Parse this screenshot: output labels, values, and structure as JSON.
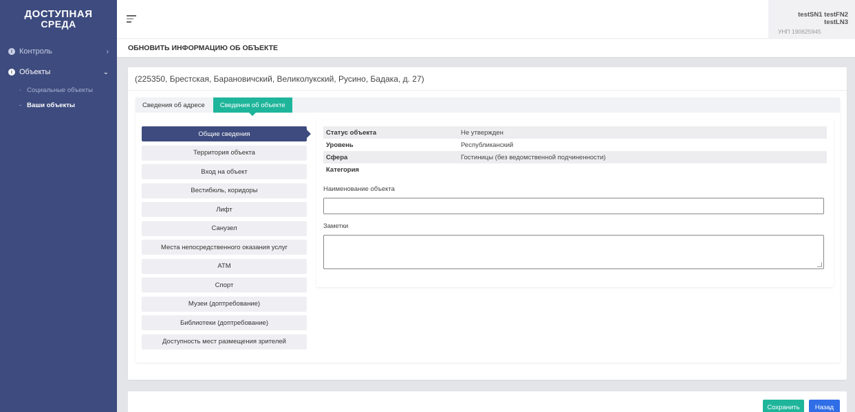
{
  "logo": {
    "line1": "ДОСТУПНАЯ",
    "line2": "СРЕДА"
  },
  "sidebar": {
    "items": [
      {
        "label": "Контроль",
        "icon": "circle-info-icon",
        "chevron": "›"
      },
      {
        "label": "Объекты",
        "icon": "circle-info-icon",
        "chevron": "⌄"
      }
    ],
    "subitems": [
      {
        "label": "Социальные объекты"
      },
      {
        "label": "Ваши объекты"
      }
    ]
  },
  "header": {
    "user_name": "testSN1 testFN2 testLN3",
    "user_sub": "УНП 190625945"
  },
  "page_title": "ОБНОВИТЬ ИНФОРМАЦИЮ ОБ ОБЪЕКТЕ",
  "address": "(225350, Брестская, Барановичский, Великолукский, Русино, Бадака, д. 27)",
  "tabs": [
    {
      "label": "Сведения об адресе"
    },
    {
      "label": "Сведения об объекте"
    }
  ],
  "side_menu": [
    {
      "label": "Общие сведения"
    },
    {
      "label": "Территория объекта"
    },
    {
      "label": "Вход на объект"
    },
    {
      "label": "Вестибюль, коридоры"
    },
    {
      "label": "Лифт"
    },
    {
      "label": "Санузел"
    },
    {
      "label": "Места непосредственного оказания услуг"
    },
    {
      "label": "АТМ"
    },
    {
      "label": "Спорт"
    },
    {
      "label": "Музеи (доптребование)"
    },
    {
      "label": "Библиотеки (доптребование)"
    },
    {
      "label": "Доступность мест размещения зрителей"
    }
  ],
  "info": [
    {
      "key": "Статус объекта",
      "value": "Не утвержден"
    },
    {
      "key": "Уровень",
      "value": "Республиканский"
    },
    {
      "key": "Сфера",
      "value": "Гостиницы (без ведомственной подчиненности)"
    },
    {
      "key": "Категория",
      "value": ""
    }
  ],
  "form": {
    "name_label": "Наименование объекта",
    "name_value": "",
    "notes_label": "Заметки",
    "notes_value": ""
  },
  "buttons": {
    "save": "Сохранить",
    "back": "Назад"
  },
  "colors": {
    "sidebar": "#3d4b7e",
    "accent": "#1eb59b",
    "primary": "#2f6ee6"
  }
}
